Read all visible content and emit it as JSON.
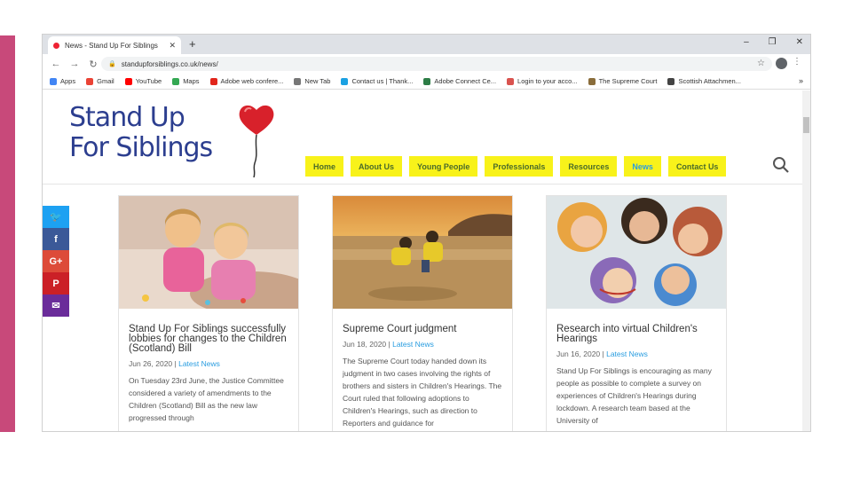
{
  "browser": {
    "tab_title": "News - Stand Up For Siblings",
    "new_tab_symbol": "+",
    "window_controls": [
      "–",
      "❐",
      "✕"
    ],
    "url": "standupforsiblings.co.uk/news/",
    "bookmarks": [
      {
        "label": "Apps",
        "icon": "apps-grid-icon",
        "color": "#4285f4"
      },
      {
        "label": "Gmail",
        "icon": "gmail-icon",
        "color": "#ea4335"
      },
      {
        "label": "YouTube",
        "icon": "youtube-icon",
        "color": "#ff0000"
      },
      {
        "label": "Maps",
        "icon": "maps-icon",
        "color": "#34a853"
      },
      {
        "label": "Adobe web confere...",
        "icon": "adobe-icon",
        "color": "#e1251b"
      },
      {
        "label": "New Tab",
        "icon": "globe-icon",
        "color": "#777777"
      },
      {
        "label": "Contact us | Thank...",
        "icon": "snowflake-icon",
        "color": "#1ba1e2"
      },
      {
        "label": "Adobe Connect Ce...",
        "icon": "adobe-connect-icon",
        "color": "#2d7d46"
      },
      {
        "label": "Login to your acco...",
        "icon": "login-icon",
        "color": "#d9534f"
      },
      {
        "label": "The Supreme Court",
        "icon": "court-icon",
        "color": "#8a6d3b"
      },
      {
        "label": "Scottish Attachmen...",
        "icon": "gear-icon",
        "color": "#444444"
      }
    ],
    "bookmarks_more": "»"
  },
  "site": {
    "logo_line1": "Stand Up",
    "logo_line2": "For Siblings",
    "menu": [
      {
        "label": "Home",
        "active": false
      },
      {
        "label": "About Us",
        "active": false
      },
      {
        "label": "Young People",
        "active": false
      },
      {
        "label": "Professionals",
        "active": false
      },
      {
        "label": "Resources",
        "active": false
      },
      {
        "label": "News",
        "active": true
      },
      {
        "label": "Contact Us",
        "active": false
      }
    ],
    "share": [
      {
        "icon": "twitter-icon",
        "glyph": "🐦",
        "color": "#1da1f2"
      },
      {
        "icon": "facebook-icon",
        "glyph": "f",
        "color": "#3b5998"
      },
      {
        "icon": "google-plus-icon",
        "glyph": "G+",
        "color": "#dd4b39"
      },
      {
        "icon": "pinterest-icon",
        "glyph": "P",
        "color": "#cb2027"
      },
      {
        "icon": "email-icon",
        "glyph": "✉",
        "color": "#6a2c9a"
      }
    ]
  },
  "posts": [
    {
      "title": "Stand Up For Siblings successfully lobbies for changes to the Children (Scotland) Bill",
      "date": "Jun 26, 2020",
      "category": "Latest News",
      "excerpt": "On Tuesday 23rd June, the Justice Committee considered a variety of amendments to the Children (Scotland) Bill as the new law progressed through"
    },
    {
      "title": "Supreme Court judgment",
      "date": "Jun 18, 2020",
      "category": "Latest News",
      "excerpt": "The Supreme Court today handed down its judgment in two cases involving the rights of brothers and sisters in Children's Hearings. The Court ruled that following adoptions to Children's Hearings, such as direction to Reporters and guidance for"
    },
    {
      "title": "Research into virtual Children's Hearings",
      "date": "Jun 16, 2020",
      "category": "Latest News",
      "excerpt": "Stand Up For Siblings is encouraging as many people as possible to complete a survey on experiences of Children's Hearings during lockdown. A research team based at the University of"
    }
  ]
}
